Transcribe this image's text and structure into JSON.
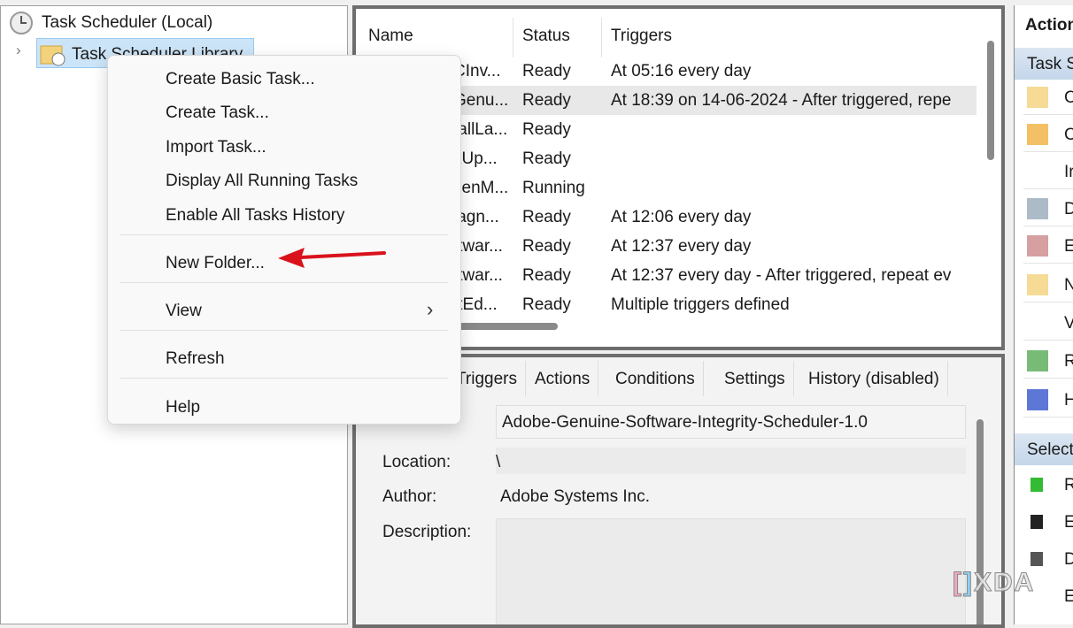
{
  "tree": {
    "root": "Task Scheduler (Local)",
    "child": "Task Scheduler Library"
  },
  "table": {
    "columns": [
      "Name",
      "Status",
      "Triggers"
    ],
    "rows": [
      {
        "name": "CInv...",
        "status": "Ready",
        "triggers": "At 05:16 every day"
      },
      {
        "name": "Genu...",
        "status": "Ready",
        "triggers": "At 18:39 on 14-06-2024 - After triggered, repe"
      },
      {
        "name": "tallLa...",
        "status": "Ready",
        "triggers": ""
      },
      {
        "name": "kUp...",
        "status": "Ready",
        "triggers": ""
      },
      {
        "name": "zenM...",
        "status": "Running",
        "triggers": ""
      },
      {
        "name": "iagn...",
        "status": "Ready",
        "triggers": "At 12:06 every day"
      },
      {
        "name": "ftwar...",
        "status": "Ready",
        "triggers": "At 12:37 every day"
      },
      {
        "name": "ftwar...",
        "status": "Ready",
        "triggers": "At 12:37 every day - After triggered, repeat ev"
      },
      {
        "name": "ftEd...",
        "status": "Ready",
        "triggers": "Multiple triggers defined"
      }
    ]
  },
  "context_menu": {
    "items": [
      "Create Basic Task...",
      "Create Task...",
      "Import Task...",
      "Display All Running Tasks",
      "Enable All Tasks History",
      "New Folder...",
      "View",
      "Refresh",
      "Help"
    ]
  },
  "details": {
    "tabs": [
      "Triggers",
      "Actions",
      "Conditions",
      "Settings",
      "History (disabled)"
    ],
    "name_value": "Adobe-Genuine-Software-Integrity-Scheduler-1.0",
    "location_label": "Location:",
    "location_value": "\\",
    "author_label": "Author:",
    "author_value": "Adobe Systems Inc.",
    "description_label": "Description:"
  },
  "actions": {
    "title": "Action",
    "section1": "Task S",
    "items1": [
      "C",
      "C",
      "Ir",
      "D",
      "E",
      "N",
      "V",
      "R",
      "H"
    ],
    "section2": "Select",
    "items2": [
      "R",
      "E",
      "D",
      "E"
    ]
  },
  "watermark": "XDA",
  "colors": {
    "arrow": "#d9121b",
    "selection": "#cce4f7",
    "band": "#c5d6ea"
  }
}
